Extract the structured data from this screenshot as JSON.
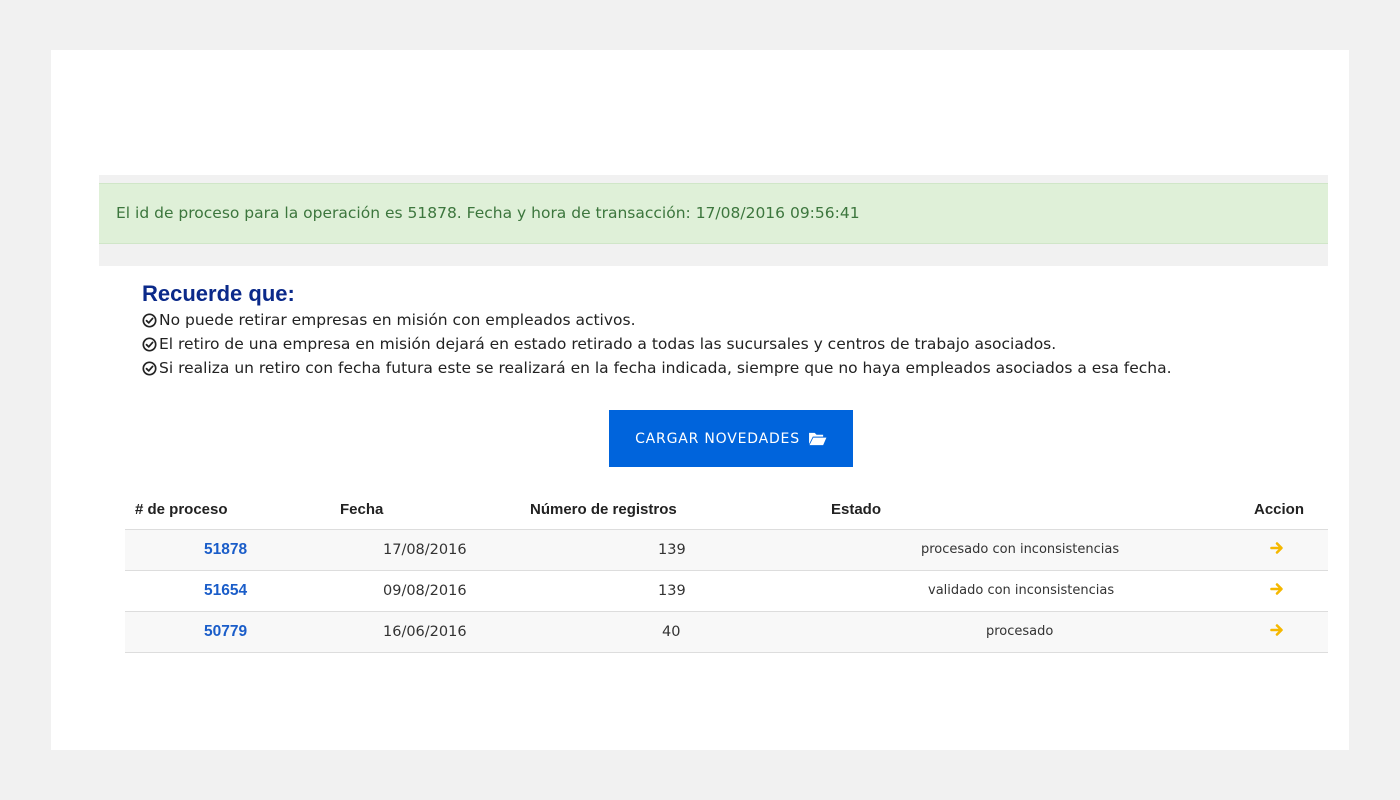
{
  "alert": {
    "message": "El id de proceso para la operación es 51878. Fecha y hora de transacción: 17/08/2016 09:56:41"
  },
  "reminder": {
    "title": "Recuerde que:",
    "items": [
      "No puede retirar empresas en misión con empleados activos.",
      "El retiro de una empresa en misión dejará en estado retirado a todas las sucursales y centros de trabajo asociados.",
      "Si realiza un retiro con fecha futura este se realizará en la fecha indicada, siempre que no haya empleados asociados a esa fecha."
    ]
  },
  "upload_button": {
    "label": "CARGAR NOVEDADES",
    "icon": "folder-open-icon"
  },
  "table": {
    "headers": {
      "process": "# de proceso",
      "date": "Fecha",
      "records": "Número de registros",
      "status": "Estado",
      "action": "Accion"
    },
    "rows": [
      {
        "process_id": "51878",
        "date": "17/08/2016",
        "records": "139",
        "status": "procesado con inconsistencias"
      },
      {
        "process_id": "51654",
        "date": "09/08/2016",
        "records": "139",
        "status": "validado con inconsistencias"
      },
      {
        "process_id": "50779",
        "date": "16/06/2016",
        "records": "40",
        "status": "procesado"
      }
    ]
  },
  "colors": {
    "accent": "#0064dc",
    "title": "#0b2a8a",
    "link": "#1a5dc9",
    "alert_bg": "#dff0d8",
    "alert_text": "#3c763d",
    "action_arrow": "#f5b800"
  }
}
